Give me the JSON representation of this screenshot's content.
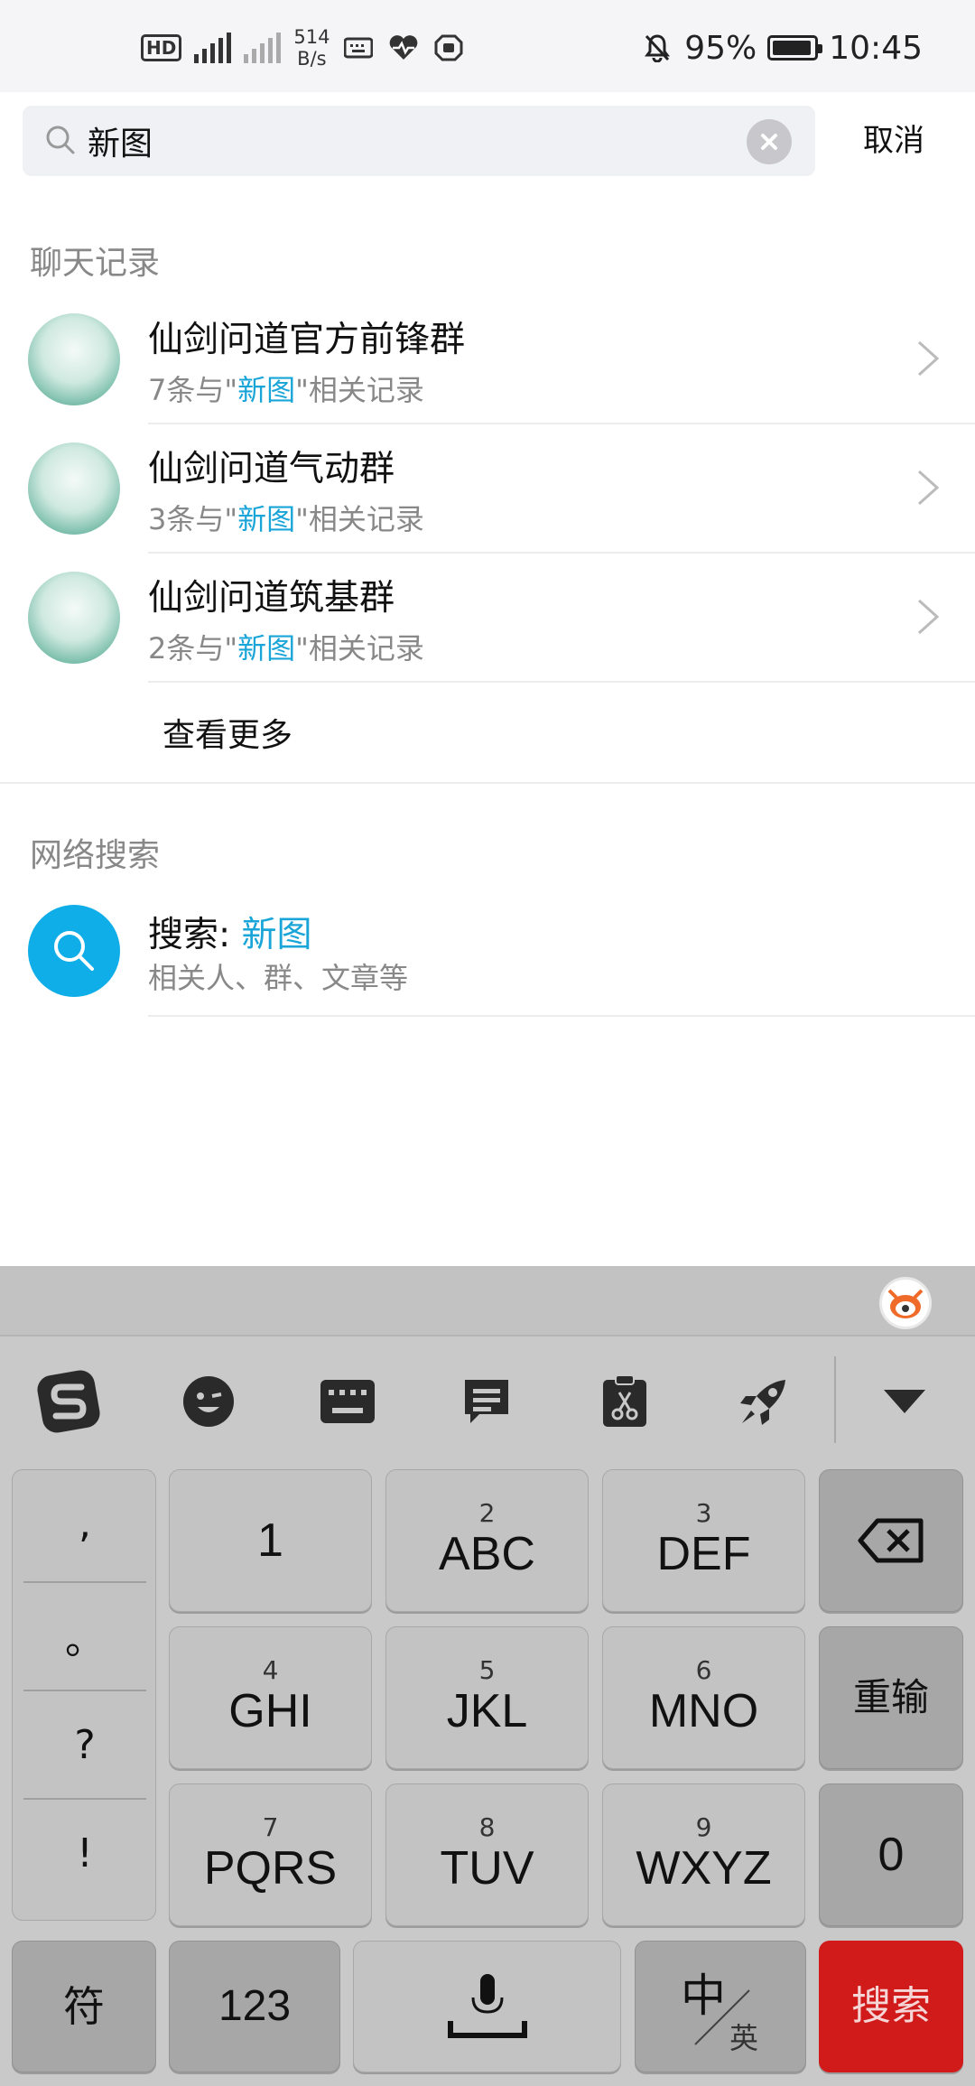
{
  "status_bar": {
    "net_speed_value": "514",
    "net_speed_unit": "B/s",
    "battery_percent": "95%",
    "time": "10:45",
    "icons": [
      "hd-icon",
      "signal-4g-icon",
      "signal-bars-icon",
      "no-signal-icon",
      "keyboard-icon",
      "health-icon",
      "shield-icon",
      "bell-off-icon",
      "battery-icon"
    ]
  },
  "search": {
    "query": "新图",
    "cancel_label": "取消"
  },
  "chat_section": {
    "title": "聊天记录",
    "results": [
      {
        "name": "仙剑问道官方前锋群",
        "count_prefix": "7条与\"",
        "keyword": "新图",
        "count_suffix": "\"相关记录"
      },
      {
        "name": "仙剑问道气动群",
        "count_prefix": "3条与\"",
        "keyword": "新图",
        "count_suffix": "\"相关记录"
      },
      {
        "name": "仙剑问道筑基群",
        "count_prefix": "2条与\"",
        "keyword": "新图",
        "count_suffix": "\"相关记录"
      }
    ],
    "more_label": "查看更多"
  },
  "web_section": {
    "title": "网络搜索",
    "item_label": "搜索: ",
    "item_keyword": "新图",
    "item_sub": "相关人、群、文章等"
  },
  "keyboard": {
    "punctuation": [
      ",",
      "。",
      "?",
      "!"
    ],
    "keys": [
      {
        "sup": "",
        "main": "1"
      },
      {
        "sup": "2",
        "main": "ABC"
      },
      {
        "sup": "3",
        "main": "DEF"
      },
      {
        "sup": "4",
        "main": "GHI"
      },
      {
        "sup": "5",
        "main": "JKL"
      },
      {
        "sup": "6",
        "main": "MNO"
      },
      {
        "sup": "7",
        "main": "PQRS"
      },
      {
        "sup": "8",
        "main": "TUV"
      },
      {
        "sup": "9",
        "main": "WXYZ"
      }
    ],
    "reset_label": "重输",
    "zero_label": "0",
    "symbol_label": "符",
    "num_label": "123",
    "lang_main": "中",
    "lang_sub": "英",
    "search_label": "搜索",
    "colors": {
      "search_key": "#d11b1b",
      "highlight": "#1aa5d8",
      "web_icon": "#10aee8"
    }
  }
}
